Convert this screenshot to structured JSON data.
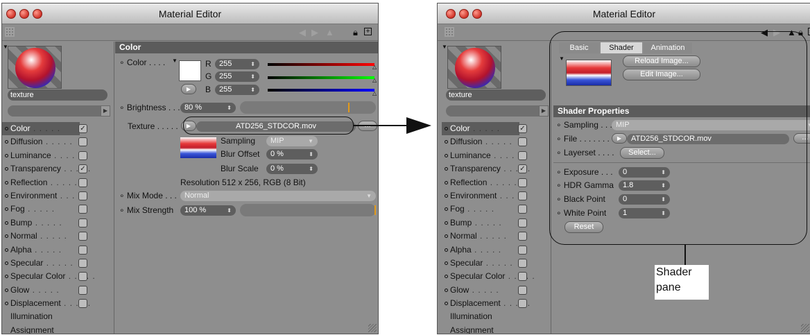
{
  "left_window": {
    "title": "Material Editor",
    "material_name": "texture",
    "channels": [
      {
        "label": "Color",
        "checked": true,
        "selected": true
      },
      {
        "label": "Diffusion",
        "checked": false
      },
      {
        "label": "Luminance",
        "checked": false
      },
      {
        "label": "Transparency",
        "checked": true
      },
      {
        "label": "Reflection",
        "checked": false
      },
      {
        "label": "Environment",
        "checked": false
      },
      {
        "label": "Fog",
        "checked": false
      },
      {
        "label": "Bump",
        "checked": false
      },
      {
        "label": "Normal",
        "checked": false
      },
      {
        "label": "Alpha",
        "checked": false
      },
      {
        "label": "Specular",
        "checked": false
      },
      {
        "label": "Specular Color",
        "checked": false
      },
      {
        "label": "Glow",
        "checked": false
      },
      {
        "label": "Displacement",
        "checked": false
      },
      {
        "label": "Illumination"
      },
      {
        "label": "Assignment"
      }
    ],
    "section_title": "Color",
    "color_label": "Color",
    "r_label": "R",
    "r_value": "255",
    "g_label": "G",
    "g_value": "255",
    "b_label": "B",
    "b_value": "255",
    "brightness_label": "Brightness",
    "brightness_value": "80 %",
    "texture_label": "Texture",
    "texture_file": "ATD256_STDCOR.mov",
    "more_button": "...",
    "sampling_label": "Sampling",
    "sampling_value": "MIP",
    "blur_offset_label": "Blur Offset",
    "blur_offset_value": "0 %",
    "blur_scale_label": "Blur Scale",
    "blur_scale_value": "0 %",
    "resolution_text": "Resolution 512 x 256, RGB (8 Bit)",
    "mix_mode_label": "Mix Mode",
    "mix_mode_value": "Normal",
    "mix_strength_label": "Mix Strength",
    "mix_strength_value": "100 %"
  },
  "right_window": {
    "title": "Material Editor",
    "material_name": "texture",
    "tabs": [
      "Basic",
      "Shader",
      "Animation"
    ],
    "active_tab": "Shader",
    "reload_button": "Reload Image...",
    "edit_button": "Edit Image...",
    "section_title": "Shader Properties",
    "sampling_label": "Sampling",
    "sampling_value": "MIP",
    "file_label": "File",
    "file_value": "ATD256_STDCOR.mov",
    "more_button": "...",
    "layerset_label": "Layerset",
    "layerset_button": "Select...",
    "exposure_label": "Exposure",
    "exposure_value": "0",
    "hdr_gamma_label": "HDR Gamma",
    "hdr_gamma_value": "1.8",
    "black_point_label": "Black Point",
    "black_point_value": "0",
    "white_point_label": "White Point",
    "white_point_value": "1",
    "reset_button": "Reset"
  },
  "callout": {
    "line1": "Shader",
    "line2": "pane"
  }
}
